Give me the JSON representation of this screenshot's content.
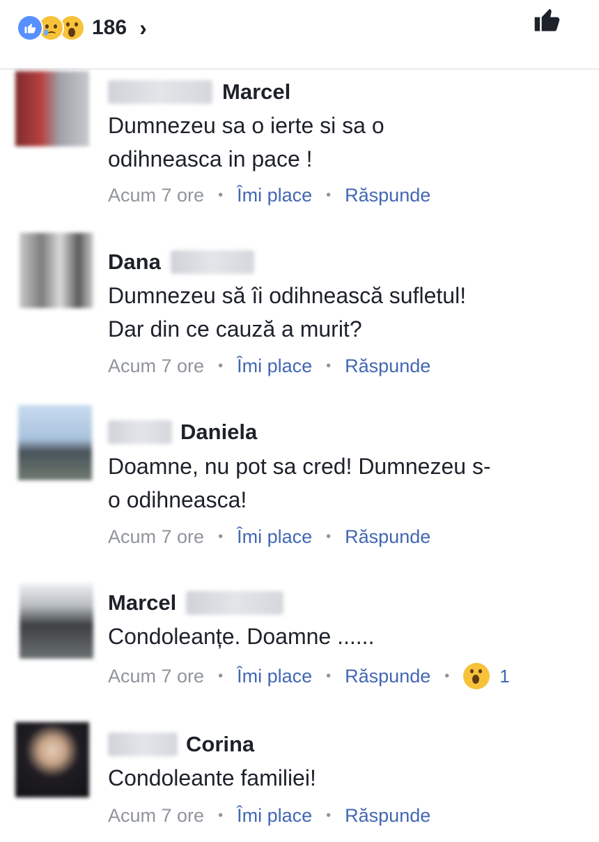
{
  "header": {
    "reactions": [
      "like",
      "sad",
      "wow"
    ],
    "reaction_count": "186",
    "chevron": "›"
  },
  "comments": [
    {
      "name": "Marcel",
      "text": [
        "Dumnezeu sa o ierte si sa o",
        "odihneasca in pace !"
      ],
      "time": "Acum 7 ore",
      "like_label": "Îmi place",
      "reply_label": "Răspunde"
    },
    {
      "name": "Dana",
      "text": [
        "Dumnezeu să îi odihnească sufletul!",
        "Dar din ce cauză a murit?"
      ],
      "time": "Acum 7 ore",
      "like_label": "Îmi place",
      "reply_label": "Răspunde"
    },
    {
      "name": "Daniela",
      "text": [
        "Doamne, nu pot sa cred! Dumnezeu s-",
        "o odihneasca!"
      ],
      "time": "Acum 7 ore",
      "like_label": "Îmi place",
      "reply_label": "Răspunde"
    },
    {
      "name": "Marcel",
      "text": [
        "Condoleanțe. Doamne ......"
      ],
      "time": "Acum 7 ore",
      "like_label": "Îmi place",
      "reply_label": "Răspunde",
      "reaction_count": "1"
    },
    {
      "name": "Corina",
      "text": [
        "Condoleante familiei!"
      ],
      "time": "Acum 7 ore",
      "like_label": "Îmi place",
      "reply_label": "Răspunde"
    }
  ],
  "colors": {
    "link_blue": "#4267b2",
    "meta_gray": "#90949c",
    "like_blue": "#5890ff",
    "emoji_yellow": "#f7c23a"
  },
  "icons": [
    "like-reaction-icon",
    "sad-reaction-icon",
    "wow-reaction-icon",
    "chevron-right-icon",
    "thumbs-up-icon"
  ]
}
